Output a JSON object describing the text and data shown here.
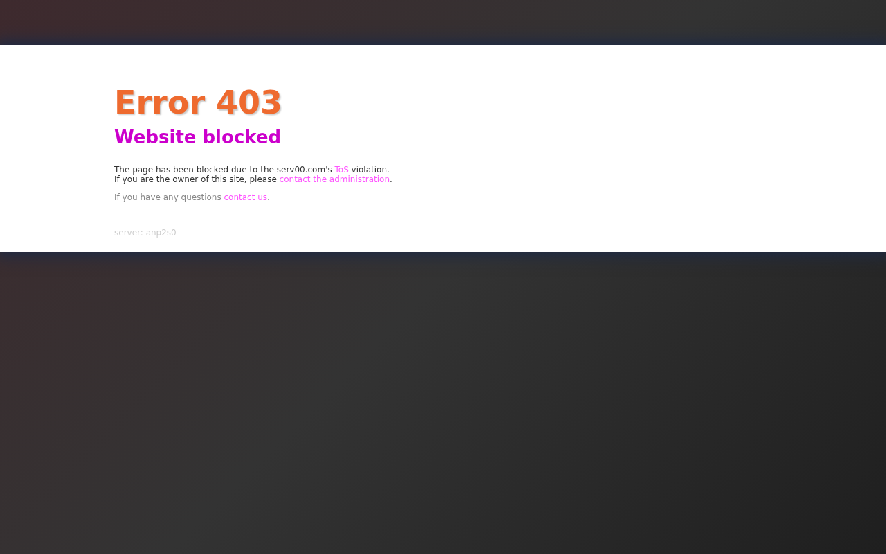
{
  "title": "Error 403",
  "subtitle": "Website blocked",
  "message_lines": [
    [
      {
        "kind": "text",
        "text": "The page has been blocked due to the serv00.com's "
      },
      {
        "kind": "link",
        "text": "ToS"
      },
      {
        "kind": "text",
        "text": " violation."
      }
    ],
    [
      {
        "kind": "text",
        "text": "If you are the owner of this site, please "
      },
      {
        "kind": "link",
        "text": "contact the administration"
      },
      {
        "kind": "text",
        "text": "."
      }
    ]
  ],
  "questions": [
    {
      "kind": "text",
      "text": "If you have any questions "
    },
    {
      "kind": "link",
      "text": "contact us"
    },
    {
      "kind": "text",
      "text": "."
    }
  ],
  "footer": "server: anp2s0"
}
